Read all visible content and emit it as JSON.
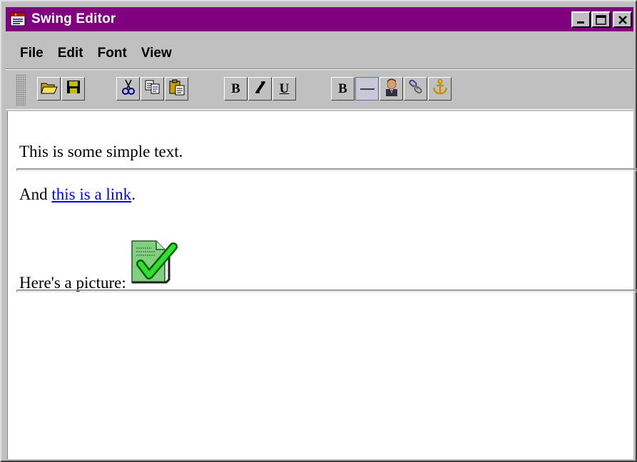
{
  "window": {
    "title": "Swing Editor",
    "icon": "app-editor-icon",
    "title_bar_color": "#800080"
  },
  "menu": {
    "items": [
      "File",
      "Edit",
      "Font",
      "View"
    ]
  },
  "toolbar": {
    "groups": [
      [
        "open-folder-icon",
        "save-disk-icon"
      ],
      [
        "cut-scissors-icon",
        "copy-icon",
        "paste-icon"
      ],
      [
        "bold",
        "italic",
        "underline"
      ],
      [
        "bold",
        "horizontal-rule-icon",
        "person-image-icon",
        "link-icon",
        "anchor-icon"
      ]
    ],
    "labels": {
      "bold": "B",
      "italic": "I",
      "underline": "U",
      "bold2": "B"
    }
  },
  "document": {
    "line1": "This is some simple text.",
    "line2_prefix": "And ",
    "link_text": "this is a link",
    "line2_suffix": ".",
    "line3": "Here's a picture: ",
    "picture": "document-checkmark-icon",
    "link_color": "#0000ee"
  }
}
